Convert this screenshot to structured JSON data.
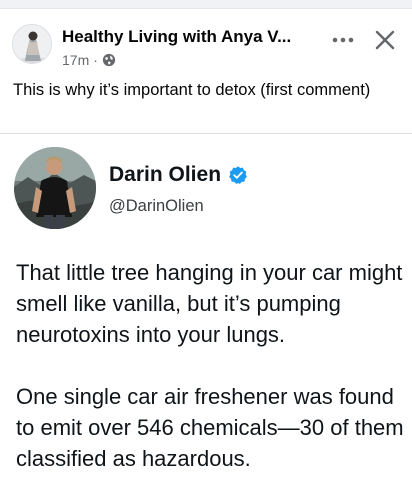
{
  "post": {
    "page_name": "Healthy Living with Anya V...",
    "time": "17m",
    "separator": "·",
    "privacy_icon": "globe-icon",
    "caption": "This is why it’s important to detox (first comment)",
    "more_icon": "more-options-icon",
    "close_icon": "close-icon"
  },
  "tweet": {
    "name": "Darin Olien",
    "handle": "@DarinOlien",
    "verified_icon": "verified-badge-icon",
    "verified_color": "#1d9bf0",
    "paragraphs": [
      "That little tree hanging in your car might smell like vanilla, but it’s pumping neurotoxins into your lungs.",
      "One single car air freshener was found to emit over 546 chemicals—30 of them classified as hazardous."
    ]
  }
}
